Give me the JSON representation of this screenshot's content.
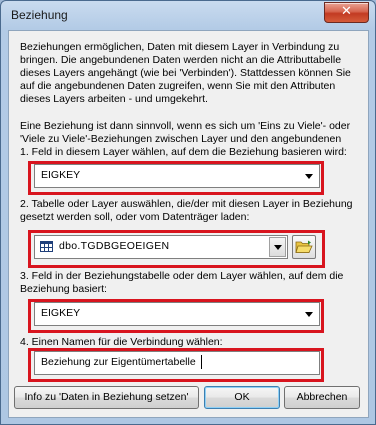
{
  "window": {
    "title": "Beziehung",
    "close_glyph": "✕"
  },
  "description": {
    "para1": [
      "Beziehungen ermöglichen, Daten mit diesem Layer in Verbindung zu",
      "bringen. Die angebundenen Daten werden nicht an die Attributtabelle",
      "dieses Layers angehängt (wie bei 'Verbinden'). Stattdessen können Sie",
      "auf die angebundenen Daten zugreifen, wenn Sie mit den Attributen",
      "dieses Layers arbeiten - und umgekehrt."
    ],
    "para2": [
      "Eine Beziehung ist dann sinnvoll, wenn es sich um  'Eins zu Viele'- oder",
      "'Viele zu Viele'-Beziehungen zwischen Layer und den angebundenen"
    ]
  },
  "step1": {
    "label": "1.  Feld in diesem Layer wählen, auf dem die Beziehung basieren wird:",
    "value": "EIGKEY"
  },
  "step2": {
    "label": [
      "2. Tabelle oder Layer auswählen, die/der mit diesen Layer in Beziehung",
      "gesetzt werden soll, oder vom Datenträger laden:"
    ],
    "value": "dbo.TGDBGEOEIGEN"
  },
  "step3": {
    "label": [
      "3. Feld in der Beziehungstabelle oder dem Layer wählen, auf dem die",
      "Beziehung basiert:"
    ],
    "value": "EIGKEY"
  },
  "step4": {
    "label": "4. Einen Namen für die Verbindung wählen:",
    "value": "Beziehung zur Eigentümertabelle"
  },
  "buttons": {
    "info": "Info zu 'Daten in Beziehung setzen'",
    "ok": "OK",
    "cancel": "Abbrechen"
  },
  "colors": {
    "highlight": "#d8141e",
    "close_red": "#c23a22"
  }
}
